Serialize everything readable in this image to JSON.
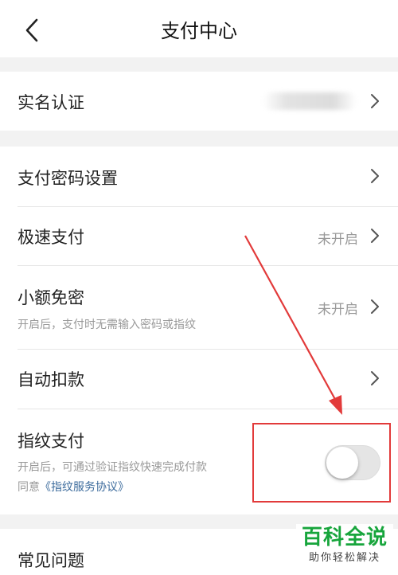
{
  "header": {
    "title": "支付中心"
  },
  "sections": {
    "realname": {
      "label": "实名认证"
    },
    "settings": {
      "password": {
        "label": "支付密码设置"
      },
      "fast_pay": {
        "label": "极速支付",
        "status": "未开启"
      },
      "small_free": {
        "label": "小额免密",
        "status": "未开启",
        "desc": "开启后，支付时无需输入密码或指纹"
      },
      "auto_debit": {
        "label": "自动扣款"
      },
      "fingerprint": {
        "label": "指纹支付",
        "desc": "开启后，可通过验证指纹快速完成付款",
        "agree_prefix": "同意",
        "agree_link": "《指纹服务协议》",
        "enabled": false
      }
    },
    "faq": {
      "label": "常见问题"
    }
  },
  "watermark": {
    "main": "百科全说",
    "sub": "助你轻松解决"
  },
  "colors": {
    "annotation": "#e23a3a",
    "link": "#3c6b9c",
    "watermark": "#17a53c"
  }
}
